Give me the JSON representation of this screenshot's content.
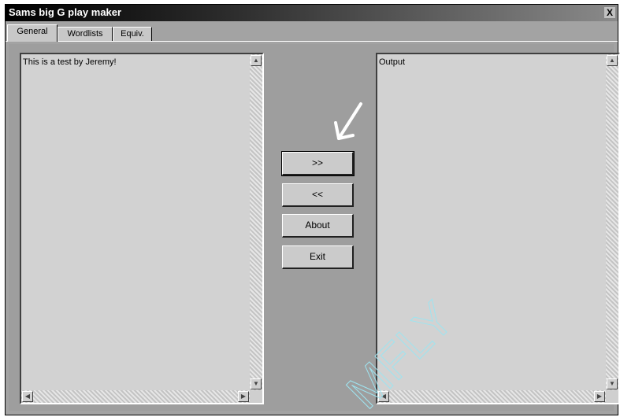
{
  "window": {
    "title": "Sams big G play maker",
    "close_glyph": "X"
  },
  "tabs": [
    {
      "label": "General",
      "active": true
    },
    {
      "label": "Wordlists",
      "active": false
    },
    {
      "label": "Equiv.",
      "active": false
    }
  ],
  "left_box": {
    "text": "This is a test by Jeremy!"
  },
  "right_box": {
    "text": "Output"
  },
  "buttons": {
    "forward_label": ">>",
    "back_label": "<<",
    "about_label": "About",
    "exit_label": "Exit"
  },
  "annotations": {
    "watermark": "MFLY",
    "arrow_color": "#ffffff",
    "watermark_color": "#9ee4f0"
  },
  "icons": {
    "scroll_up": "triangle-up-icon",
    "scroll_down": "triangle-down-icon",
    "scroll_left": "triangle-left-icon",
    "scroll_right": "triangle-right-icon"
  }
}
